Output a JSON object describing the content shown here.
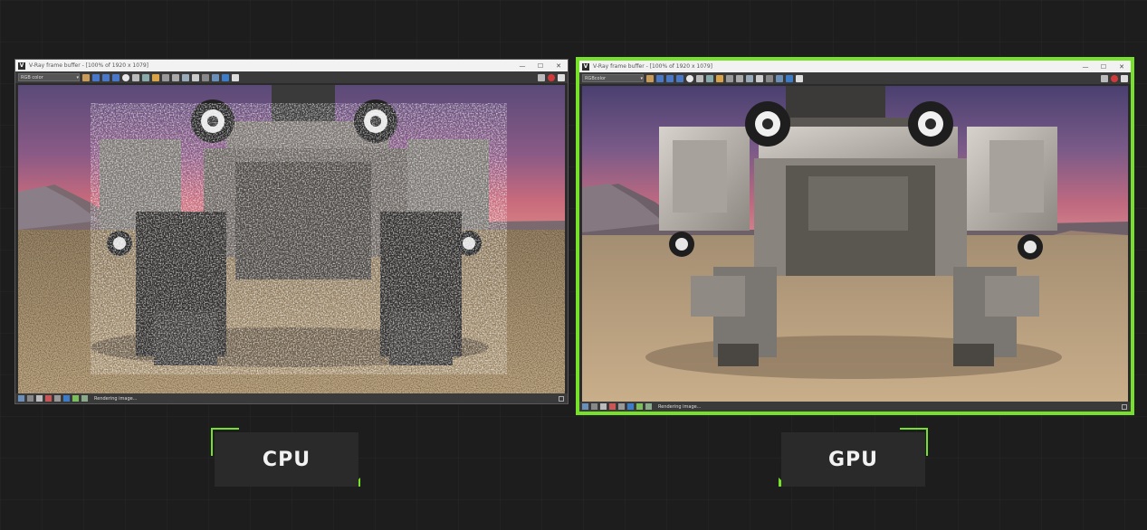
{
  "cpu_panel": {
    "window_title": "V-Ray frame buffer - [100% of 1920 x 1079]",
    "channel": "RGB color",
    "status_text": "Rendering image...",
    "label": "CPU"
  },
  "gpu_panel": {
    "window_title": "V-Ray frame buffer - [100% of 1920 x 1079]",
    "channel": "RGBcolor",
    "status_text": "Rendering image...",
    "label": "GPU"
  },
  "window_buttons": {
    "minimize": "—",
    "maximize": "☐",
    "close": "✕"
  },
  "colors": {
    "accent_green": "#76e02a",
    "background": "#1d1d1d",
    "label_bg": "#2a2a2a"
  },
  "icons": [
    "vray-logo-icon",
    "color-correction-icon",
    "channel-icon",
    "save-icon",
    "clear-icon",
    "region-render-icon",
    "render-icon",
    "stop-render-icon"
  ]
}
